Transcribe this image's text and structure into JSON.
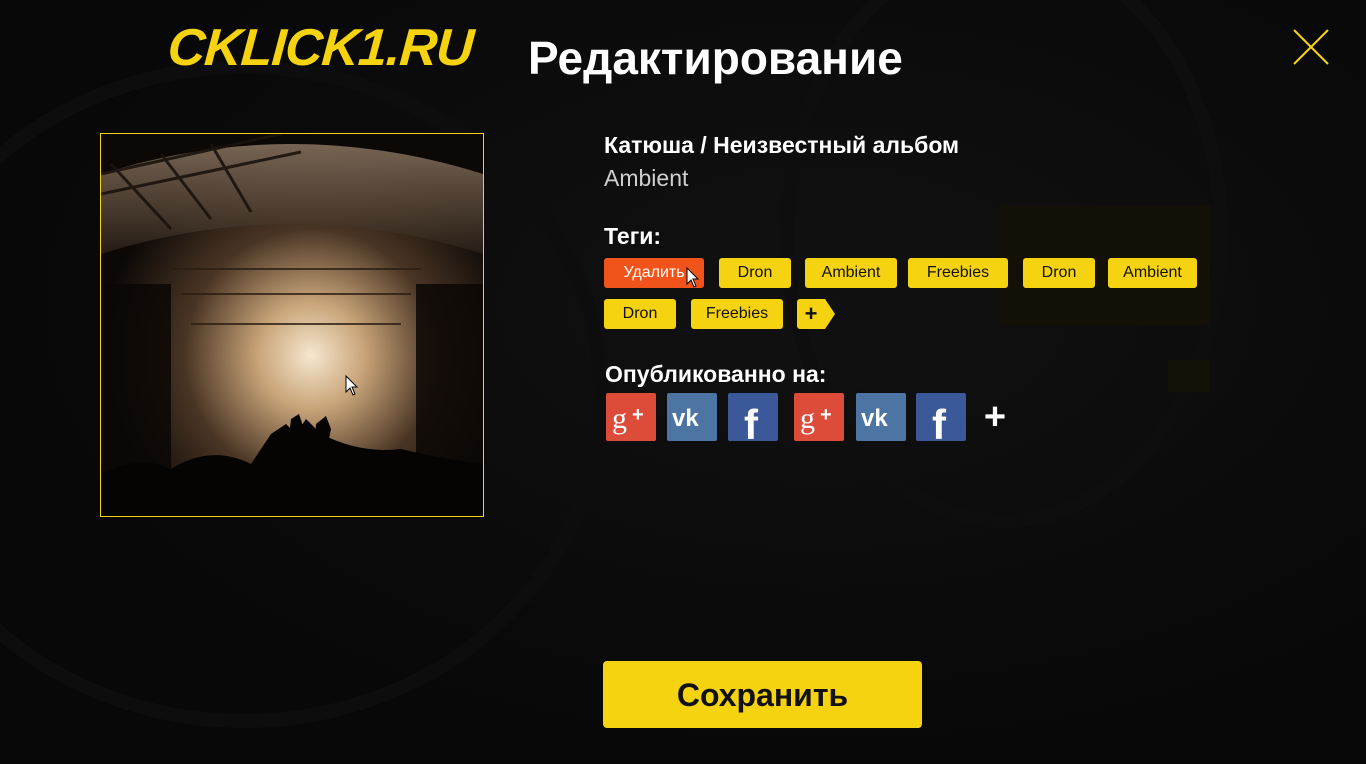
{
  "header": {
    "logo_text": "CKLICK1.RU",
    "title": "Редактирование",
    "close_icon": "close-icon"
  },
  "track": {
    "title": "Катюша / Неизвестный альбом",
    "genre": "Ambient"
  },
  "tags_section": {
    "label": "Теги:",
    "delete_label": "Удалить",
    "tags": [
      "Dron",
      "Ambient",
      "Freebies",
      "Dron",
      "Ambient",
      "Dron",
      "Freebies"
    ],
    "add_label": "+"
  },
  "published_section": {
    "label": "Опубликованно на:",
    "services": [
      "google-plus",
      "vk",
      "facebook",
      "google-plus",
      "vk",
      "facebook"
    ],
    "add_label": "+"
  },
  "save_button": {
    "label": "Сохранить"
  },
  "colors": {
    "accent": "#f5d311",
    "delete": "#f0541a",
    "google_plus": "#dd4b39",
    "vk": "#4c75a3",
    "facebook": "#3b5998"
  }
}
